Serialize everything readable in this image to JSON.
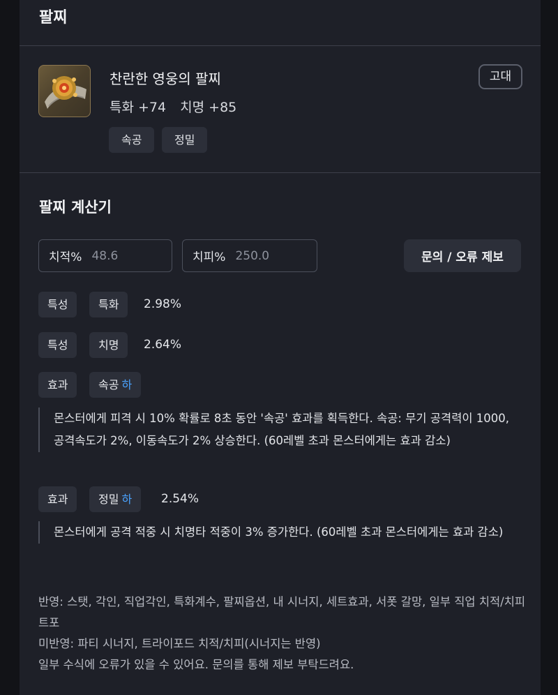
{
  "panel": {
    "title": "팔찌"
  },
  "item": {
    "name": "찬란한 영웅의 팔찌",
    "stats": [
      {
        "label": "특화 +74"
      },
      {
        "label": "치명 +85"
      }
    ],
    "tags": [
      "속공",
      "정밀"
    ],
    "grade": "고대"
  },
  "calculator": {
    "title": "팔찌 계산기",
    "crit_rate": {
      "label": "치적%",
      "value": "48.6"
    },
    "crit_dmg": {
      "label": "치피%",
      "value": "250.0"
    },
    "report_button": "문의 / 오류 제보",
    "rows": [
      {
        "type": "특성",
        "name": "특화",
        "level": "",
        "value": "2.98%"
      },
      {
        "type": "특성",
        "name": "치명",
        "level": "",
        "value": "2.64%"
      },
      {
        "type": "효과",
        "name": "속공",
        "level": "하",
        "value": "",
        "desc": "몬스터에게 피격 시 10% 확률로 8초 동안 '속공' 효과를 획득한다. 속공: 무기 공격력이 1000, 공격속도가 2%, 이동속도가 2% 상승한다. (60레벨 초과 몬스터에게는 효과 감소)"
      },
      {
        "type": "효과",
        "name": "정밀",
        "level": "하",
        "value": "2.54%",
        "desc": "몬스터에게 공격 적중 시 치명타 적중이 3% 증가한다. (60레벨 초과 몬스터에게는 효과 감소)"
      }
    ],
    "notes": [
      "반영: 스탯, 각인, 직업각인, 특화계수, 팔찌옵션, 내 시너지, 세트효과, 서폿 갈망, 일부 직업 치적/치피 트포",
      "미반영: 파티 시너지, 트라이포드 치적/치피(시너지는 반영)",
      "일부 수식에 오류가 있을 수 있어요. 문의를 통해 제보 부탁드려요."
    ]
  }
}
